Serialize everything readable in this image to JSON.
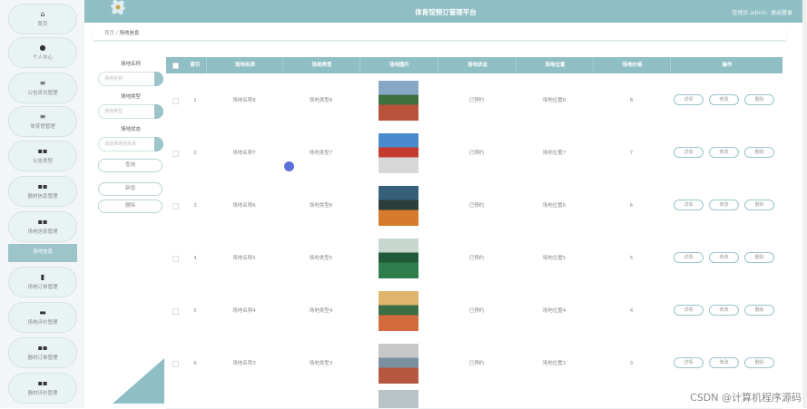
{
  "app": {
    "title": "体育馆预订管理平台",
    "user": "管理员 admin",
    "logout": "退出登录"
  },
  "breadcrumb": {
    "home": "首页",
    "separator": "/",
    "current": "场地信息"
  },
  "sidebar": {
    "items": [
      {
        "label": "首页",
        "icon": "home-icon",
        "glyph": "⌂"
      },
      {
        "label": "个人中心",
        "icon": "user-icon",
        "glyph": "●"
      },
      {
        "label": "公告资讯管理",
        "icon": "list-icon",
        "glyph": "≡"
      },
      {
        "label": "体育馆管理",
        "icon": "list-icon",
        "glyph": "≡"
      },
      {
        "label": "公告类型",
        "icon": "grid-icon",
        "glyph": "▪▪"
      },
      {
        "label": "器材信息管理",
        "icon": "grid-icon",
        "glyph": "▪▪"
      },
      {
        "label": "场地信息管理",
        "icon": "grid-icon",
        "glyph": "▪▪"
      },
      {
        "label": "场地信息",
        "icon": "",
        "glyph": "",
        "active": true
      },
      {
        "label": "场地订单管理",
        "icon": "chart-icon",
        "glyph": "▮"
      },
      {
        "label": "场地评价管理",
        "icon": "comment-icon",
        "glyph": "▬"
      },
      {
        "label": "器材订单管理",
        "icon": "grid-icon",
        "glyph": "▪▪"
      },
      {
        "label": "器材评价管理",
        "icon": "grid-icon",
        "glyph": "▪▪"
      }
    ]
  },
  "filters": {
    "name_label": "场地名称",
    "name_placeholder": "场地名称",
    "type_label": "场地类型",
    "type_placeholder": "场地类型",
    "status_label": "场地状态",
    "status_placeholder": "请选择场地状态",
    "search_button": "查询",
    "add_button": "新增",
    "delete_button": "删除"
  },
  "table": {
    "headers": [
      "索引",
      "场地名称",
      "场地类型",
      "场地图片",
      "场地状态",
      "场地位置",
      "场地价格",
      "操作"
    ],
    "actions": {
      "detail": "详情",
      "edit": "修改",
      "delete": "删除"
    },
    "rows": [
      {
        "index": "1",
        "name": "场地名称8",
        "type": "场地类型8",
        "status": "已预约",
        "location": "场地位置8",
        "price": "8"
      },
      {
        "index": "2",
        "name": "场地名称7",
        "type": "场地类型7",
        "status": "已预约",
        "location": "场地位置7",
        "price": "7"
      },
      {
        "index": "3",
        "name": "场地名称6",
        "type": "场地类型6",
        "status": "已预约",
        "location": "场地位置6",
        "price": "6"
      },
      {
        "index": "4",
        "name": "场地名称5",
        "type": "场地类型5",
        "status": "已预约",
        "location": "场地位置5",
        "price": "5"
      },
      {
        "index": "5",
        "name": "场地名称4",
        "type": "场地类型4",
        "status": "已预约",
        "location": "场地位置4",
        "price": "4"
      },
      {
        "index": "6",
        "name": "场地名称3",
        "type": "场地类型3",
        "status": "已预约",
        "location": "场地位置3",
        "price": "3"
      }
    ]
  },
  "watermark": "CSDN @计算机程序源码",
  "colors": {
    "accent": "#8fbec4",
    "active_nav": "#9cc4c9"
  }
}
